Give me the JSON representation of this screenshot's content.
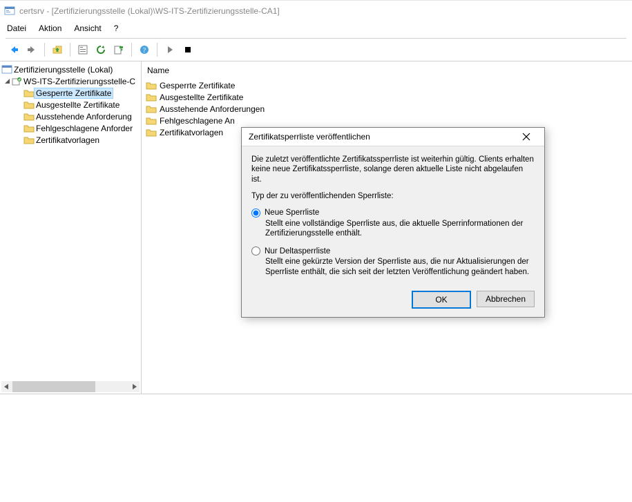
{
  "window": {
    "title": "certsrv - [Zertifizierungsstelle (Lokal)\\WS-ITS-Zertifizierungsstelle-CA1]"
  },
  "menu": {
    "file": "Datei",
    "action": "Aktion",
    "view": "Ansicht",
    "help": "?"
  },
  "tree": {
    "root": "Zertifizierungsstelle (Lokal)",
    "ca": "WS-ITS-Zertifizierungsstelle-C",
    "items": [
      "Gesperrte Zertifikate",
      "Ausgestellte Zertifikate",
      "Ausstehende Anforderung",
      "Fehlgeschlagene Anforder",
      "Zertifikatvorlagen"
    ]
  },
  "list": {
    "header": "Name",
    "items": [
      "Gesperrte Zertifikate",
      "Ausgestellte Zertifikate",
      "Ausstehende Anforderungen",
      "Fehlgeschlagene Anforderungen",
      "Zertifikatvorlagen"
    ],
    "items_clipped": [
      "Gesperrte Zertifikate",
      "Ausgestellte Zertifikate",
      "Ausstehende Anforderungen",
      "Fehlgeschlagene An",
      "Zertifikatvorlagen"
    ]
  },
  "dialog": {
    "title": "Zertifikatsperrliste veröffentlichen",
    "intro": "Die zuletzt veröffentlichte Zertifikatssperrliste ist weiterhin gültig. Clients erhalten keine neue Zertifikatssperrliste, solange deren aktuelle Liste nicht abgelaufen ist.",
    "type_label": "Typ der zu veröffentlichenden Sperrliste:",
    "opt1": {
      "label": "Neue Sperrliste",
      "desc": "Stellt eine vollständige Sperrliste aus, die aktuelle Sperrinformationen der Zertifizierungsstelle enthält."
    },
    "opt2": {
      "label": "Nur Deltasperrliste",
      "desc": "Stellt eine gekürzte Version der Sperrliste aus, die nur Aktualisierungen der Sperrliste enthält, die sich seit der letzten Veröffentlichung geändert haben."
    },
    "ok": "OK",
    "cancel": "Abbrechen"
  }
}
